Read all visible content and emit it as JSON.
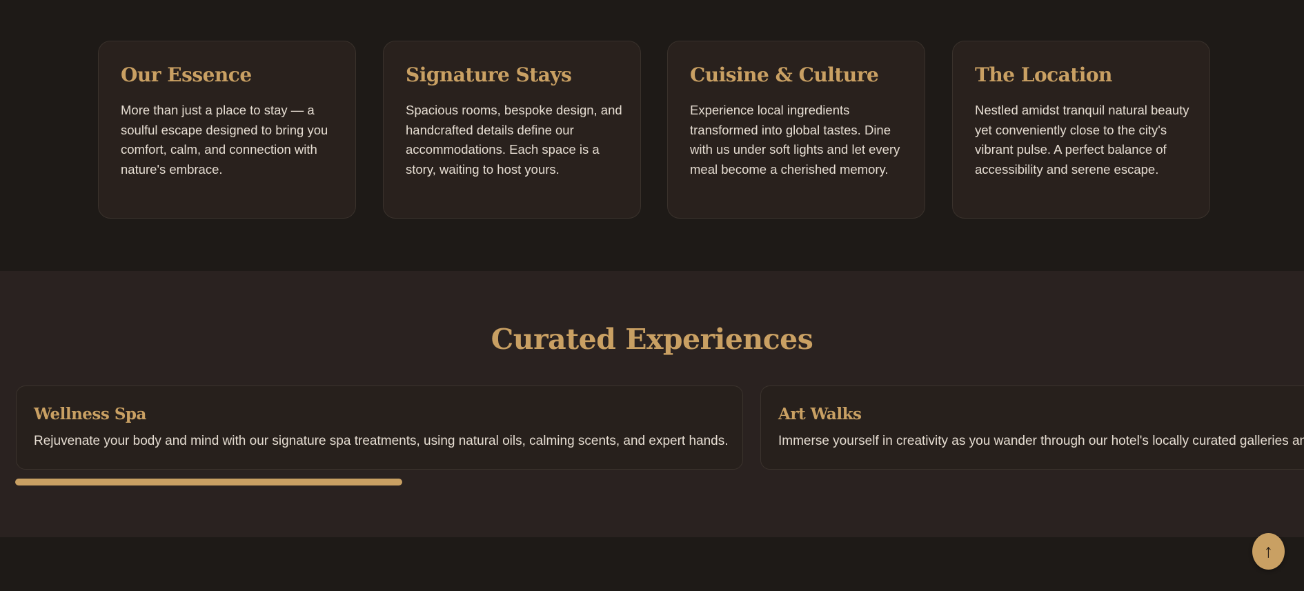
{
  "features": [
    {
      "title": "Our Essence",
      "text": "More than just a place to stay — a soulful escape designed to bring you comfort, calm, and connection with nature's embrace."
    },
    {
      "title": "Signature Stays",
      "text": "Spacious rooms, bespoke design, and handcrafted details define our accommodations. Each space is a story, waiting to host yours."
    },
    {
      "title": "Cuisine & Culture",
      "text": "Experience local ingredients transformed into global tastes. Dine with us under soft lights and let every meal become a cherished memory."
    },
    {
      "title": "The Location",
      "text": "Nestled amidst tranquil natural beauty yet conveniently close to the city's vibrant pulse. A perfect balance of accessibility and serene escape."
    }
  ],
  "experiences": {
    "title": "Curated Experiences",
    "cards": [
      {
        "title": "Wellness Spa",
        "text": "Rejuvenate your body and mind with our signature spa treatments, using natural oils, calming scents, and expert hands."
      },
      {
        "title": "Art Walks",
        "text": "Immerse yourself in creativity as you wander through our hotel's locally curated galleries and"
      }
    ],
    "scroll_position_fraction": 0.0,
    "scroll_visible_fraction": 0.304
  },
  "back_to_top": {
    "icon": "arrow-up-icon",
    "glyph": "↑"
  },
  "colors": {
    "accent": "#c9a063",
    "page_background": "#1e1a17",
    "section_background": "#2a2220",
    "text": "#e6ddd2"
  }
}
